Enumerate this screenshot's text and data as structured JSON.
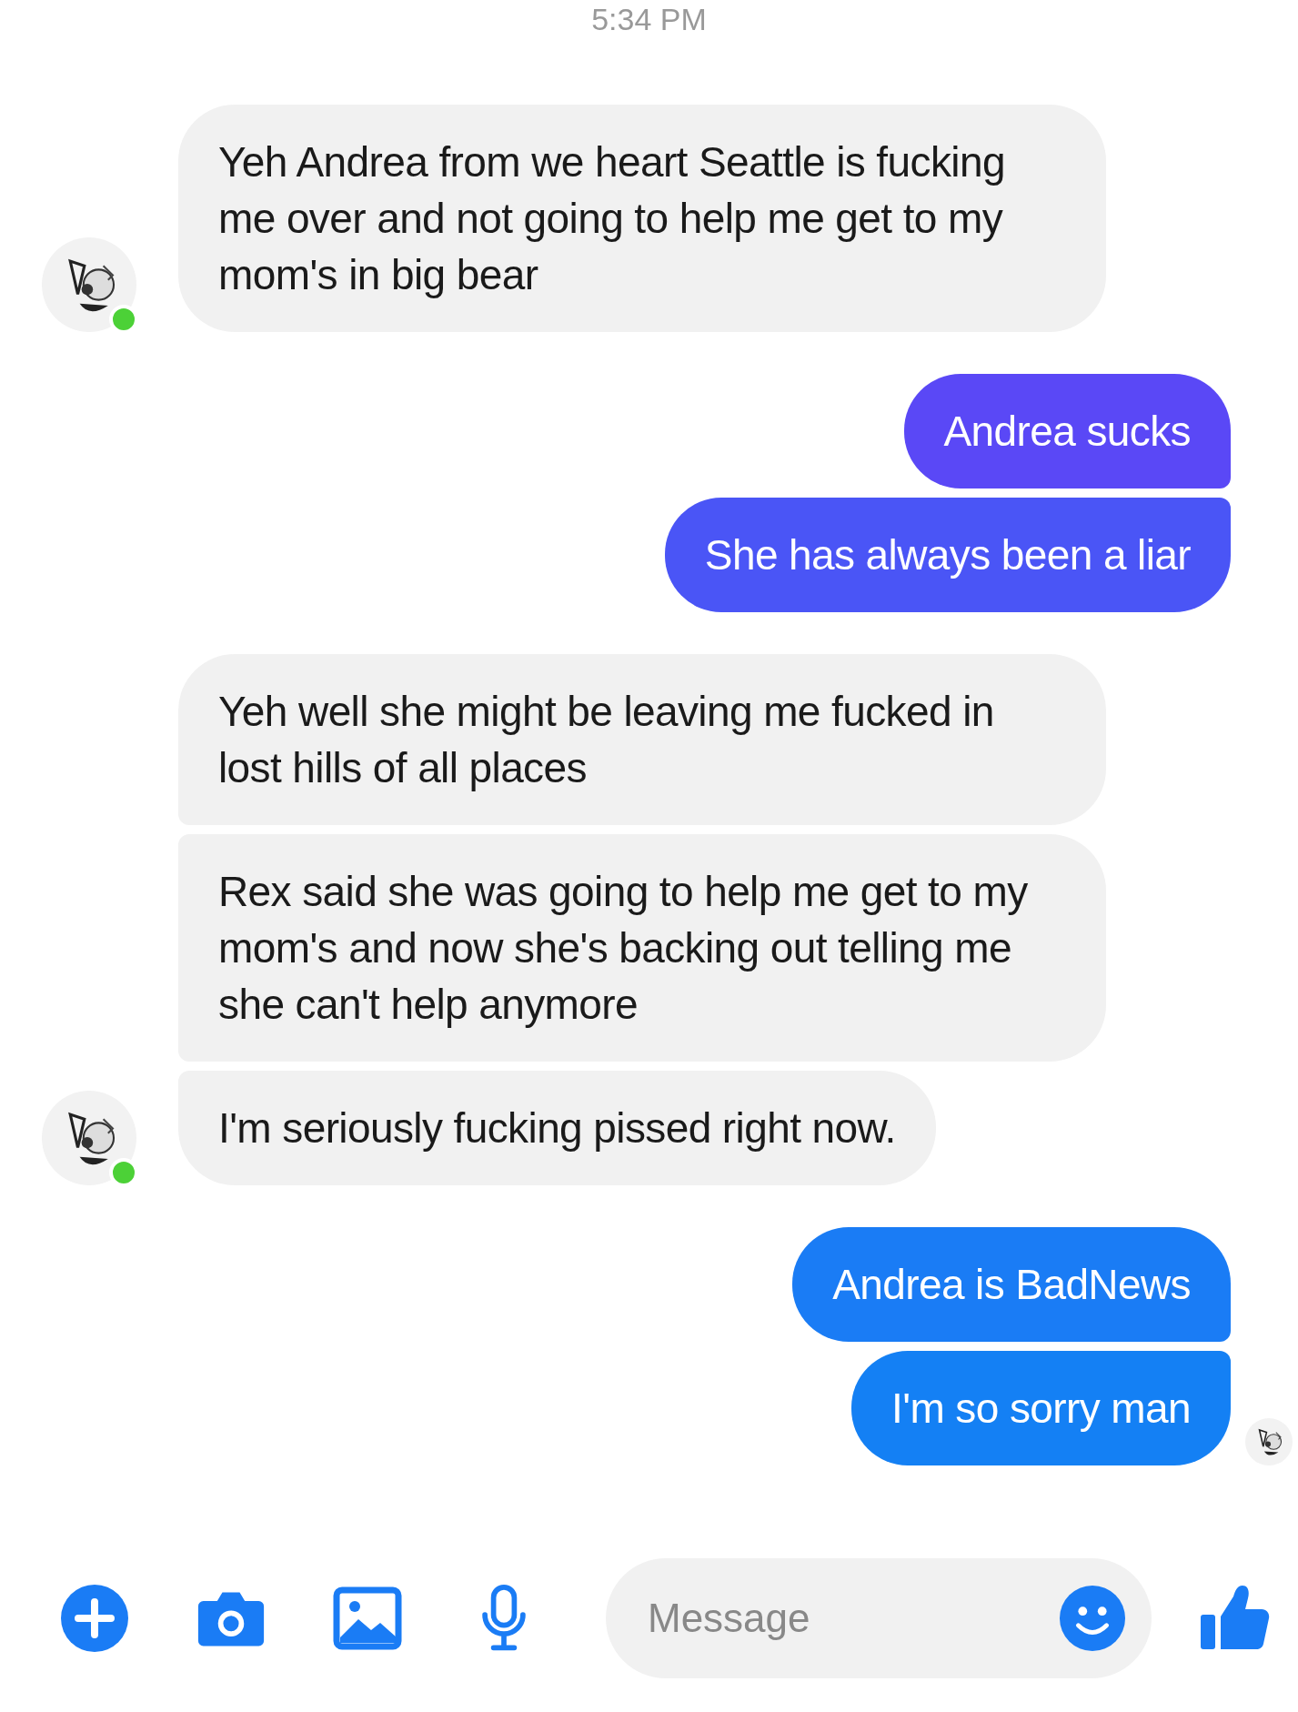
{
  "timestamp": "5:34 PM",
  "messages": [
    {
      "kind": "received",
      "text": "Yeh Andrea from we heart Seattle is fucking me over and not going to help me get to my mom's in big bear",
      "avatar": true,
      "online": true
    },
    {
      "kind": "sent",
      "text": "Andrea sucks",
      "color": "#5a48f6"
    },
    {
      "kind": "sent",
      "text": "She has always been a liar",
      "color": "#4a55f6"
    },
    {
      "kind": "received",
      "text": "Yeh well she might be leaving me fucked in lost hills of all places",
      "avatar": false
    },
    {
      "kind": "received",
      "text": "Rex said she was going to help me get to my mom's and now she's backing out telling me she can't help anymore",
      "avatar": false
    },
    {
      "kind": "received",
      "text": "I'm seriously fucking pissed right now.",
      "avatar": true,
      "online": true
    },
    {
      "kind": "sent",
      "text": "Andrea is BadNews",
      "color": "#1a7cf5"
    },
    {
      "kind": "sent",
      "text": "I'm so sorry man",
      "color": "#1480f4",
      "seen": true
    }
  ],
  "composer": {
    "placeholder": "Message"
  }
}
